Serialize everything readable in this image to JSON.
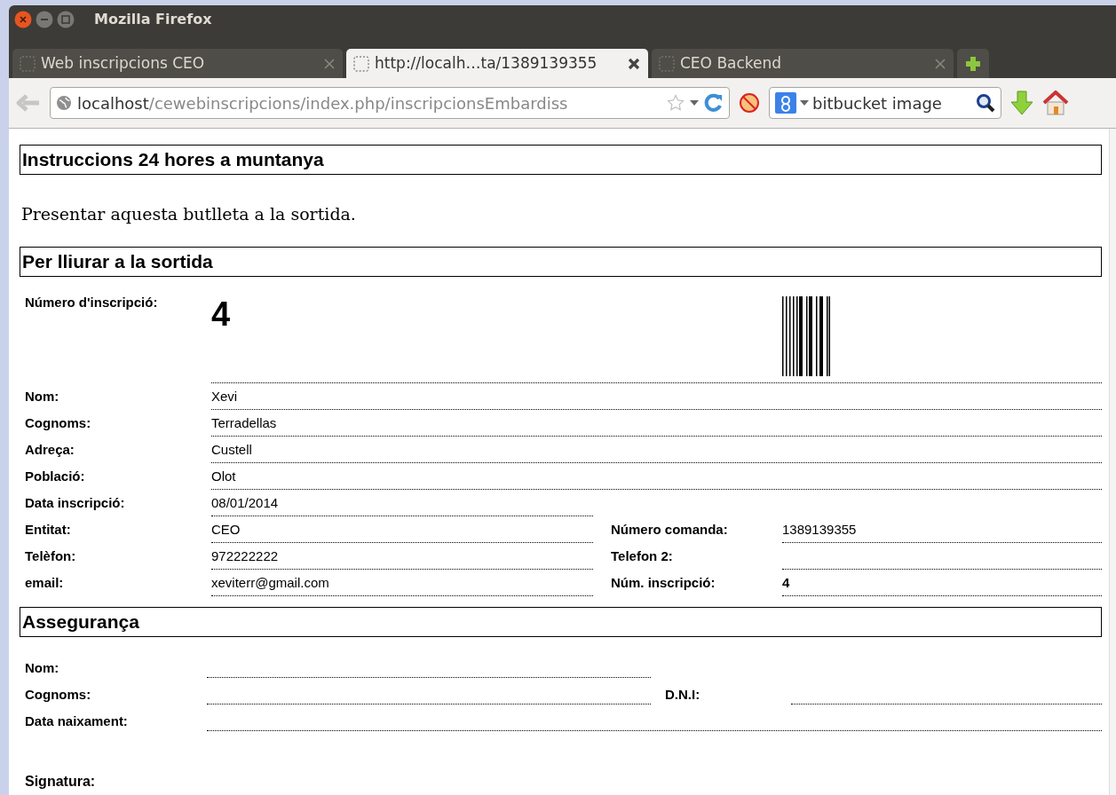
{
  "window": {
    "title": "Mozilla Firefox"
  },
  "tabs": [
    {
      "label": "Web inscripcions CEO",
      "selected": false
    },
    {
      "label": "http://localh…ta/1389139355",
      "selected": true
    },
    {
      "label": "CEO Backend",
      "selected": false
    }
  ],
  "toolbar": {
    "url_host": "localhost",
    "url_path": "/cewebinscripcions/index.php/inscripcionsEmbardiss",
    "search_value": "bitbucket image"
  },
  "page": {
    "heading_instructions": "Instruccions 24 hores a muntanya",
    "intro": "Presentar aquesta butlleta a la sortida.",
    "heading_delivery": "Per lliurar a la sortida",
    "registration": {
      "label": "Número d'inscripció:",
      "value": "4"
    },
    "fields": [
      {
        "kind": "full",
        "label": "Nom:",
        "value": "Xevi"
      },
      {
        "kind": "full",
        "label": "Cognoms:",
        "value": "Terradellas"
      },
      {
        "kind": "full",
        "label": "Adreça:",
        "value": "Custell"
      },
      {
        "kind": "full",
        "label": "Població:",
        "value": "Olot"
      },
      {
        "kind": "split",
        "label": "Data inscripció:",
        "value": "08/01/2014"
      },
      {
        "kind": "split",
        "label": "Entitat:",
        "value": "CEO",
        "right_label": "Número comanda:",
        "right_value": "1389139355"
      },
      {
        "kind": "split",
        "label": "Telèfon:",
        "value": "972222222",
        "right_label": "Telefon 2:"
      },
      {
        "kind": "split",
        "label": "email:",
        "value": "xeviterr@gmail.com",
        "right_label": "Núm. inscripció:",
        "right_value": "4",
        "right_bold": true
      }
    ],
    "heading_insurance": "Assegurança",
    "insurance_fields": [
      {
        "kind": "split",
        "label": "Nom:"
      },
      {
        "kind": "split",
        "label": "Cognoms:",
        "right_label": "D.N.I:"
      },
      {
        "kind": "full",
        "label": "Data naixament:"
      }
    ],
    "signature_label": "Signatura:"
  }
}
